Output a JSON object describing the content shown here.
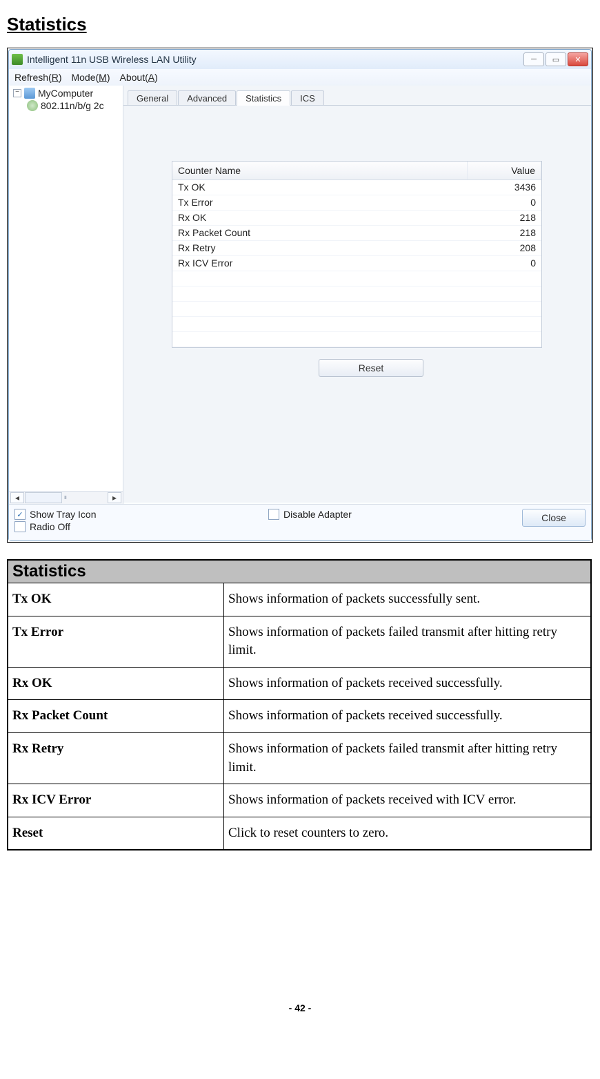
{
  "page_heading": "Statistics",
  "window": {
    "title": "Intelligent 11n USB Wireless LAN Utility",
    "menu": {
      "refresh": "Refresh(",
      "refresh_u": "R",
      "refresh_end": ")",
      "mode": "Mode(",
      "mode_u": "M",
      "mode_end": ")",
      "about": "About(",
      "about_u": "A",
      "about_end": ")"
    },
    "tree": {
      "root": "MyComputer",
      "child": "802.11n/b/g 2c",
      "hscroll_content": "III"
    },
    "tabs": [
      "General",
      "Advanced",
      "Statistics",
      "ICS"
    ],
    "active_tab_index": 2,
    "table": {
      "header": {
        "name": "Counter Name",
        "value": "Value"
      },
      "rows": [
        {
          "name": "Tx OK",
          "value": "3436"
        },
        {
          "name": "Tx Error",
          "value": "0"
        },
        {
          "name": "Rx OK",
          "value": "218"
        },
        {
          "name": "Rx Packet Count",
          "value": "218"
        },
        {
          "name": "Rx Retry",
          "value": "208"
        },
        {
          "name": "Rx ICV Error",
          "value": "0"
        }
      ],
      "empty_rows": 5
    },
    "reset_label": "Reset",
    "footer": {
      "show_tray": {
        "label": "Show Tray Icon",
        "checked": true
      },
      "radio_off": {
        "label": "Radio Off",
        "checked": false
      },
      "disable_adapter": {
        "label": "Disable Adapter",
        "checked": false
      },
      "close": "Close"
    }
  },
  "desc": {
    "title": "Statistics",
    "rows": [
      {
        "term": "Tx OK",
        "def": "Shows information of packets successfully sent."
      },
      {
        "term": "Tx Error",
        "def": "Shows information of packets failed transmit after hitting retry limit."
      },
      {
        "term": "Rx OK",
        "def": "Shows information of packets received successfully."
      },
      {
        "term": "Rx Packet Count",
        "def": "Shows information of packets received successfully."
      },
      {
        "term": "Rx Retry",
        "def": "Shows information of packets failed transmit after hitting retry limit."
      },
      {
        "term": "Rx ICV Error",
        "def": "Shows information of packets received with ICV error."
      },
      {
        "term": "Reset",
        "def": "Click to reset counters to zero."
      }
    ]
  },
  "page_number": "- 42 -"
}
